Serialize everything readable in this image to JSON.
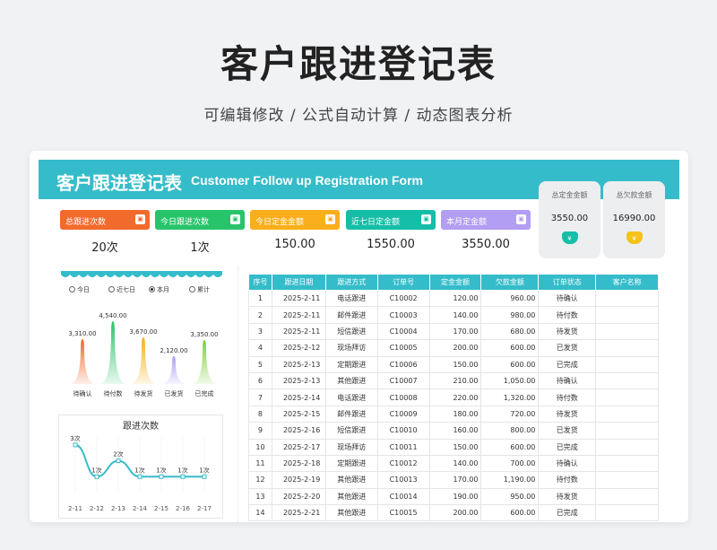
{
  "header": {
    "title": "客户跟进登记表",
    "subtitle": "可编辑修改 /  公式自动计算  /  动态图表分析"
  },
  "banner": {
    "title_cn": "客户跟进登记表",
    "title_en": "Customer Follow up Registration Form"
  },
  "kpis": [
    {
      "label": "总跟进次数",
      "value": "20次",
      "color": "#f26a2c"
    },
    {
      "label": "今日跟进次数",
      "value": "1次",
      "color": "#27c46b"
    },
    {
      "label": "今日定金金额",
      "value": "150.00",
      "color": "#f9ae1b"
    },
    {
      "label": "近七日定金额",
      "value": "1550.00",
      "color": "#14bea7"
    },
    {
      "label": "本月定金额",
      "value": "3550.00",
      "color": "#b29ef2"
    }
  ],
  "summary": [
    {
      "label": "总定金金额",
      "value": "3550.00",
      "icon": "money-bag-icon",
      "color": "#14bea7"
    },
    {
      "label": "总欠款金额",
      "value": "16990.00",
      "icon": "money-bag-icon",
      "color": "#f5c21b"
    }
  ],
  "filter": {
    "options": [
      "今日",
      "近七日",
      "本月",
      "累计"
    ],
    "selected": "本月"
  },
  "status_chart": {
    "categories": [
      "待确认",
      "待付数",
      "待发货",
      "已发货",
      "已完成"
    ],
    "values": [
      "3,310.00",
      "4,540.00",
      "3,670.00",
      "2,120.00",
      "3,350.00"
    ],
    "colors": [
      "#f26a2c",
      "#27c46b",
      "#f9ae1b",
      "#b29ef2",
      "#7fcf3a"
    ]
  },
  "chart_data": {
    "type": "line",
    "title": "跟进次数",
    "categories": [
      "2-11",
      "2-12",
      "2-13",
      "2-14",
      "2-15",
      "2-16",
      "2-17"
    ],
    "values": [
      3,
      1,
      2,
      1,
      1,
      1,
      1
    ],
    "data_labels": [
      "3次",
      "1次",
      "2次",
      "1次",
      "1次",
      "1次",
      "1次"
    ],
    "ylim": [
      0,
      3.5
    ],
    "color": "#35bcca",
    "grid": true
  },
  "table": {
    "headers": [
      "序号",
      "跟进日期",
      "跟进方式",
      "订单号",
      "定金金额",
      "欠款金额",
      "订单状态",
      "客户名称"
    ],
    "rows": [
      [
        "1",
        "2025-2-11",
        "电话跟进",
        "C10002",
        "120.00",
        "960.00",
        "待确认",
        ""
      ],
      [
        "2",
        "2025-2-11",
        "邮件跟进",
        "C10003",
        "140.00",
        "980.00",
        "待付数",
        ""
      ],
      [
        "3",
        "2025-2-11",
        "短信跟进",
        "C10004",
        "170.00",
        "680.00",
        "待发货",
        ""
      ],
      [
        "4",
        "2025-2-12",
        "现场拜访",
        "C10005",
        "200.00",
        "600.00",
        "已发货",
        ""
      ],
      [
        "5",
        "2025-2-13",
        "定期跟进",
        "C10006",
        "150.00",
        "600.00",
        "已完成",
        ""
      ],
      [
        "6",
        "2025-2-13",
        "其他跟进",
        "C10007",
        "210.00",
        "1,050.00",
        "待确认",
        ""
      ],
      [
        "7",
        "2025-2-14",
        "电话跟进",
        "C10008",
        "220.00",
        "1,320.00",
        "待付数",
        ""
      ],
      [
        "8",
        "2025-2-15",
        "邮件跟进",
        "C10009",
        "180.00",
        "720.00",
        "待发货",
        ""
      ],
      [
        "9",
        "2025-2-16",
        "短信跟进",
        "C10010",
        "160.00",
        "800.00",
        "已发货",
        ""
      ],
      [
        "10",
        "2025-2-17",
        "现场拜访",
        "C10011",
        "150.00",
        "600.00",
        "已完成",
        ""
      ],
      [
        "11",
        "2025-2-18",
        "定期跟进",
        "C10012",
        "140.00",
        "700.00",
        "待确认",
        ""
      ],
      [
        "12",
        "2025-2-19",
        "其他跟进",
        "C10013",
        "170.00",
        "1,190.00",
        "待付数",
        ""
      ],
      [
        "13",
        "2025-2-20",
        "其他跟进",
        "C10014",
        "190.00",
        "950.00",
        "待发货",
        ""
      ],
      [
        "14",
        "2025-2-21",
        "其他跟进",
        "C10015",
        "200.00",
        "600.00",
        "已完成",
        ""
      ]
    ]
  }
}
